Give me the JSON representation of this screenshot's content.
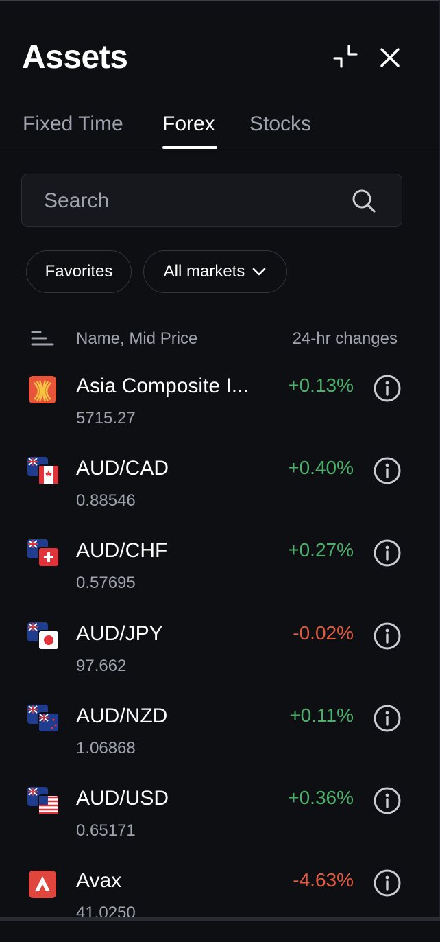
{
  "header": {
    "title": "Assets"
  },
  "tabs": [
    {
      "label": "Fixed Time",
      "active": false
    },
    {
      "label": "Forex",
      "active": true
    },
    {
      "label": "Stocks",
      "active": false
    }
  ],
  "search": {
    "placeholder": "Search",
    "value": ""
  },
  "filters": {
    "favorites_label": "Favorites",
    "markets_label": "All markets"
  },
  "list_header": {
    "name_label": "Name, Mid Price",
    "change_label": "24-hr changes"
  },
  "assets": [
    {
      "name": "Asia Composite I...",
      "price": "5715.27",
      "change": "+0.13%",
      "direction": "up",
      "icon": "asia-composite-icon"
    },
    {
      "name": "AUD/CAD",
      "price": "0.88546",
      "change": "+0.40%",
      "direction": "up",
      "icon": "aud-cad-flags-icon"
    },
    {
      "name": "AUD/CHF",
      "price": "0.57695",
      "change": "+0.27%",
      "direction": "up",
      "icon": "aud-chf-flags-icon"
    },
    {
      "name": "AUD/JPY",
      "price": "97.662",
      "change": "-0.02%",
      "direction": "down",
      "icon": "aud-jpy-flags-icon"
    },
    {
      "name": "AUD/NZD",
      "price": "1.06868",
      "change": "+0.11%",
      "direction": "up",
      "icon": "aud-nzd-flags-icon"
    },
    {
      "name": "AUD/USD",
      "price": "0.65171",
      "change": "+0.36%",
      "direction": "up",
      "icon": "aud-usd-flags-icon"
    },
    {
      "name": "Avax",
      "price": "41.0250",
      "change": "-4.63%",
      "direction": "down",
      "icon": "avax-icon"
    }
  ],
  "colors": {
    "background": "#0d0f13",
    "positive": "#4caf6a",
    "negative": "#e25a3f",
    "muted": "#9ea3ad"
  }
}
